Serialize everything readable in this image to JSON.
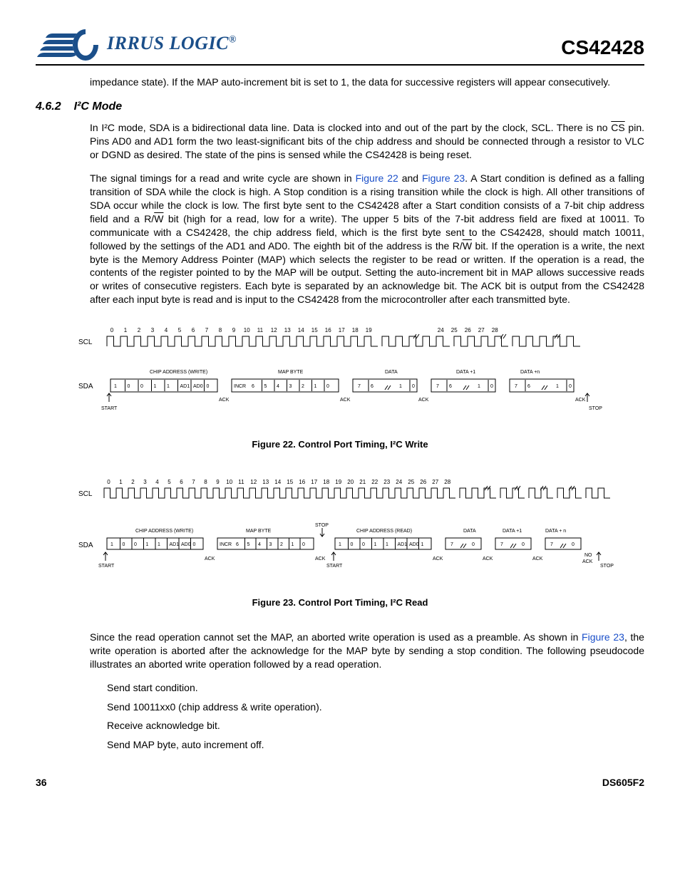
{
  "header": {
    "logo_text": "IRRUS LOGIC",
    "part_number": "CS42428"
  },
  "intro_para": "impedance state). If the MAP auto-increment bit is set to 1, the data for successive registers will appear consecutively.",
  "section": {
    "num": "4.6.2",
    "title": "I²C Mode"
  },
  "para1_a": "In I²C mode, SDA is a bidirectional data line. Data is clocked into and out of the part by the clock, SCL. There is no ",
  "para1_cs": "CS",
  "para1_b": " pin. Pins AD0 and AD1 form the two least-significant bits of the chip address and should be connected through a resistor to VLC or DGND as desired. The state of the pins is sensed while the CS42428 is being reset.",
  "para2_a": "The signal timings for a read and write cycle are shown in ",
  "para2_fig22": "Figure 22",
  "para2_b": " and ",
  "para2_fig23": "Figure 23",
  "para2_c": ". A Start condition is defined as a falling transition of SDA while the clock is high. A Stop condition is a rising transition while the clock is high. All other transitions of SDA occur while the clock is low. The first byte sent to the CS42428 after a Start condition consists of a 7-bit chip address field and a R/",
  "para2_w1": "W",
  "para2_d": " bit (high for a read, low for a write). The upper 5 bits of the 7-bit address field are fixed at 10011. To communicate with a CS42428, the chip address field, which is the first byte sent to the CS42428, should match 10011, followed by the settings of the AD1 and AD0. The eighth bit of the address is the R/",
  "para2_w2": "W",
  "para2_e": " bit. If the operation is a write, the next byte is the Memory Address Pointer (MAP) which selects the register to be read or written. If the operation is a read, the contents of the register pointed to by the MAP will be output. Setting the auto-increment bit in MAP allows successive reads or writes of consecutive registers. Each byte is separated by an acknowledge bit. The ACK bit is output from the CS42428 after each input byte is read and is input to the CS42428 from the microcontroller after each transmitted byte.",
  "fig22_caption": "Figure 22.  Control Port Timing, I²C Write",
  "fig23_caption": "Figure 23.  Control Port Timing, I²C Read",
  "para3_a": "Since the read operation cannot set the MAP, an aborted write operation is used as a preamble. As shown in ",
  "para3_fig23": "Figure 23",
  "para3_b": ", the write operation is aborted after the acknowledge for the MAP byte by sending a stop condition. The following pseudocode illustrates an aborted write operation followed by a read operation.",
  "steps": [
    "Send start condition.",
    "Send 10011xx0 (chip address & write operation).",
    "Receive acknowledge bit.",
    "Send MAP byte, auto increment off."
  ],
  "footer": {
    "page": "36",
    "doc": "DS605F2"
  },
  "timing_labels": {
    "scl": "SCL",
    "sda": "SDA",
    "chip_addr_write": "CHIP ADDRESS (WRITE)",
    "chip_addr_read": "CHIP ADDRESS (READ)",
    "map_byte": "MAP BYTE",
    "data": "DATA",
    "data_p1": "DATA +1",
    "data_pn": "DATA +n",
    "data_pn_sp": "DATA + n",
    "ack": "ACK",
    "no_ack": "NO\nACK",
    "start": "START",
    "stop": "STOP",
    "incr": "INCR",
    "addr_bits": [
      "1",
      "0",
      "0",
      "1",
      "1",
      "AD1",
      "AD0",
      "0"
    ],
    "addr_bits_read": [
      "1",
      "0",
      "0",
      "1",
      "1",
      "AD1",
      "AD0",
      "1"
    ],
    "map_bits": [
      "6",
      "5",
      "4",
      "3",
      "2",
      "1",
      "0"
    ],
    "data_bits_a": [
      "7",
      "6"
    ],
    "data_bits_b": [
      "1",
      "0"
    ],
    "data_bits_c": [
      "7"
    ],
    "data_bits_d": [
      "0"
    ],
    "ticks22_a": [
      "0",
      "1",
      "2",
      "3",
      "4",
      "5",
      "6",
      "7",
      "8",
      "9",
      "10",
      "11",
      "12",
      "13",
      "14",
      "15",
      "16",
      "17",
      "18",
      "19"
    ],
    "ticks22_b": [
      "24",
      "25",
      "26",
      "27",
      "28"
    ],
    "ticks23_a": [
      "0",
      "1",
      "2",
      "3",
      "4",
      "5",
      "6",
      "7",
      "8",
      "9",
      "10",
      "11",
      "12",
      "13",
      "14",
      "15",
      "16",
      "17",
      "18",
      "19",
      "20",
      "21",
      "22",
      "23",
      "24",
      "25",
      "26",
      "27",
      "28"
    ]
  }
}
